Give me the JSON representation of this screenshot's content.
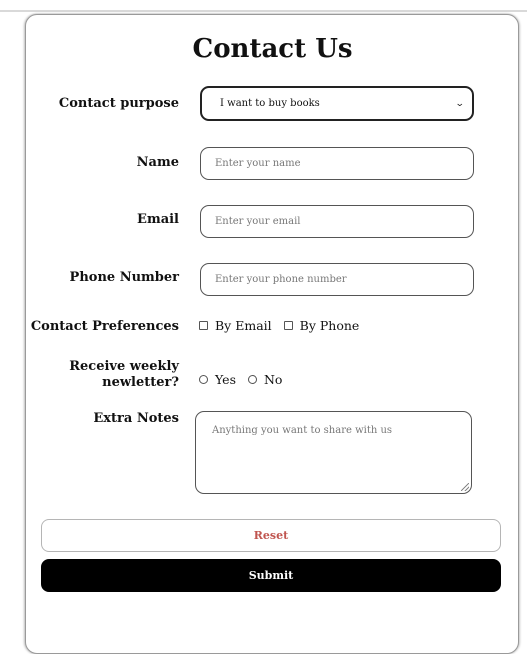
{
  "form": {
    "title": "Contact Us",
    "contact_purpose": {
      "label": "Contact purpose",
      "selected": "I want to buy books"
    },
    "name": {
      "label": "Name",
      "placeholder": "Enter your name"
    },
    "email": {
      "label": "Email",
      "placeholder": "Enter your email"
    },
    "phone": {
      "label": "Phone Number",
      "placeholder": "Enter your phone number"
    },
    "preferences": {
      "label": "Contact Preferences",
      "options": [
        "By Email",
        "By Phone"
      ]
    },
    "newsletter": {
      "label_line1": "Receive weekly",
      "label_line2": "newletter?",
      "options": [
        "Yes",
        "No"
      ]
    },
    "notes": {
      "label": "Extra Notes",
      "placeholder": "Anything you want to share with us"
    },
    "reset_label": "Reset",
    "submit_label": "Submit"
  }
}
